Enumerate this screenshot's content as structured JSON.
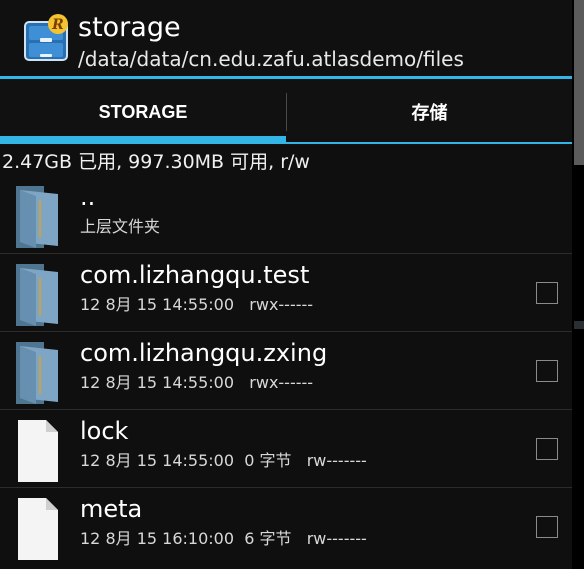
{
  "action_bar": {
    "icon": "root-explorer-cabinet-icon",
    "icon_letter": "R",
    "title": "storage",
    "path": "/data/data/cn.edu.zafu.atlasdemo/files"
  },
  "tabs": [
    {
      "label": "STORAGE",
      "selected": true
    },
    {
      "label": "存储",
      "selected": false
    }
  ],
  "status": {
    "text": "2.47GB 已用, 997.30MB 可用, r/w"
  },
  "files": [
    {
      "name": "..",
      "meta": "上层文件夹",
      "type": "folder",
      "has_checkbox": false
    },
    {
      "name": "com.lizhangqu.test",
      "meta": "12 8月 15 14:55:00   rwx------",
      "type": "folder",
      "has_checkbox": true
    },
    {
      "name": "com.lizhangqu.zxing",
      "meta": "12 8月 15 14:55:00   rwx------",
      "type": "folder",
      "has_checkbox": true
    },
    {
      "name": "lock",
      "meta": "12 8月 15 14:55:00  0 字节   rw-------",
      "type": "file",
      "has_checkbox": true
    },
    {
      "name": "meta",
      "meta": "12 8月 15 16:10:00  6 字节   rw-------",
      "type": "file",
      "has_checkbox": true
    }
  ],
  "colors": {
    "accent": "#33b5e5",
    "background": "#0f0f0f",
    "folder": "#5f86a3"
  }
}
